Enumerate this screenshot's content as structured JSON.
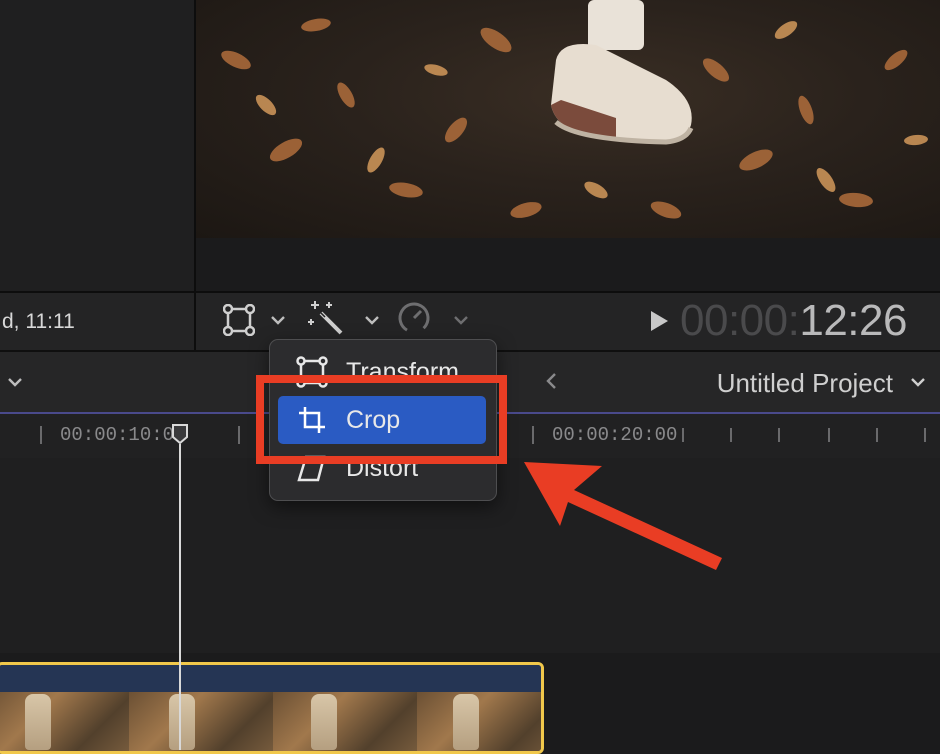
{
  "browser": {
    "status_text": "d, 11:11"
  },
  "viewer": {
    "playback_timecode": {
      "dim": "00:00:",
      "bright": "12:26"
    }
  },
  "toolbar": {
    "transform_tool_icon": "transform-icon",
    "enhance_tool_icon": "magic-wand-icon",
    "retime_tool_icon": "speedometer-icon"
  },
  "project": {
    "title": "Untitled Project"
  },
  "timeline": {
    "ruler_labels": [
      "00:00:10:00",
      "00:00:20:00"
    ]
  },
  "transform_menu": {
    "items": [
      {
        "label": "Transform",
        "icon": "transform-icon",
        "selected": false
      },
      {
        "label": "Crop",
        "icon": "crop-icon",
        "selected": true
      },
      {
        "label": "Distort",
        "icon": "distort-icon",
        "selected": false
      }
    ]
  },
  "colors": {
    "selection_blue": "#2a5bc3",
    "annotation_red": "#e93d24",
    "clip_border": "#f1c84b"
  }
}
